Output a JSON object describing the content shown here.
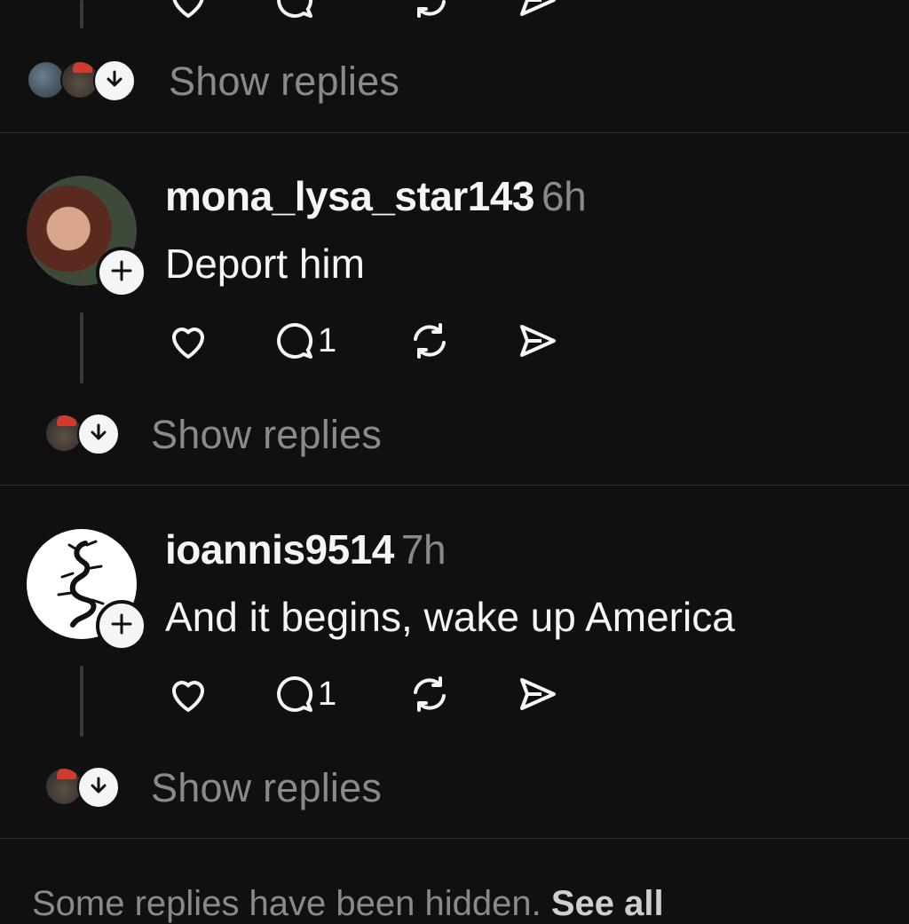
{
  "top_post": {
    "show_replies": "Show replies"
  },
  "posts": [
    {
      "username": "mona_lysa_star143",
      "time": "6h",
      "text": "Deport him",
      "reply_count": "1",
      "show_replies": "Show replies"
    },
    {
      "username": "ioannis9514",
      "time": "7h",
      "text": "And it begins, wake up America",
      "reply_count": "1",
      "show_replies": "Show replies"
    }
  ],
  "footer": {
    "hidden_text": "Some replies have been hidden.",
    "see_all": "See all"
  },
  "colors": {
    "background": "#101010",
    "text": "#f3f5f7",
    "muted": "#8a8a8a",
    "divider": "#2d2d2d"
  }
}
